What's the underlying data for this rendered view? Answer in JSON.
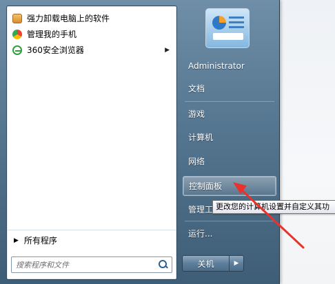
{
  "programs": [
    {
      "label": "强力卸载电脑上的软件",
      "icon": "uninstall-icon"
    },
    {
      "label": "管理我的手机",
      "icon": "phone-manager-icon"
    },
    {
      "label": "360安全浏览器",
      "icon": "browser-icon",
      "has_submenu": true
    }
  ],
  "all_programs": "所有程序",
  "search": {
    "placeholder": "搜索程序和文件"
  },
  "right_menu": {
    "user": "Administrator",
    "documents": "文档",
    "games": "游戏",
    "computer": "计算机",
    "network": "网络",
    "control_panel": "控制面板",
    "admin_tools": "管理工",
    "run": "运行..."
  },
  "shutdown": {
    "label": "关机"
  },
  "tooltip": "更改您的计算机设置并自定义其功",
  "colors": {
    "annotation_arrow": "#e8322b",
    "menu_blue": "#557690"
  }
}
